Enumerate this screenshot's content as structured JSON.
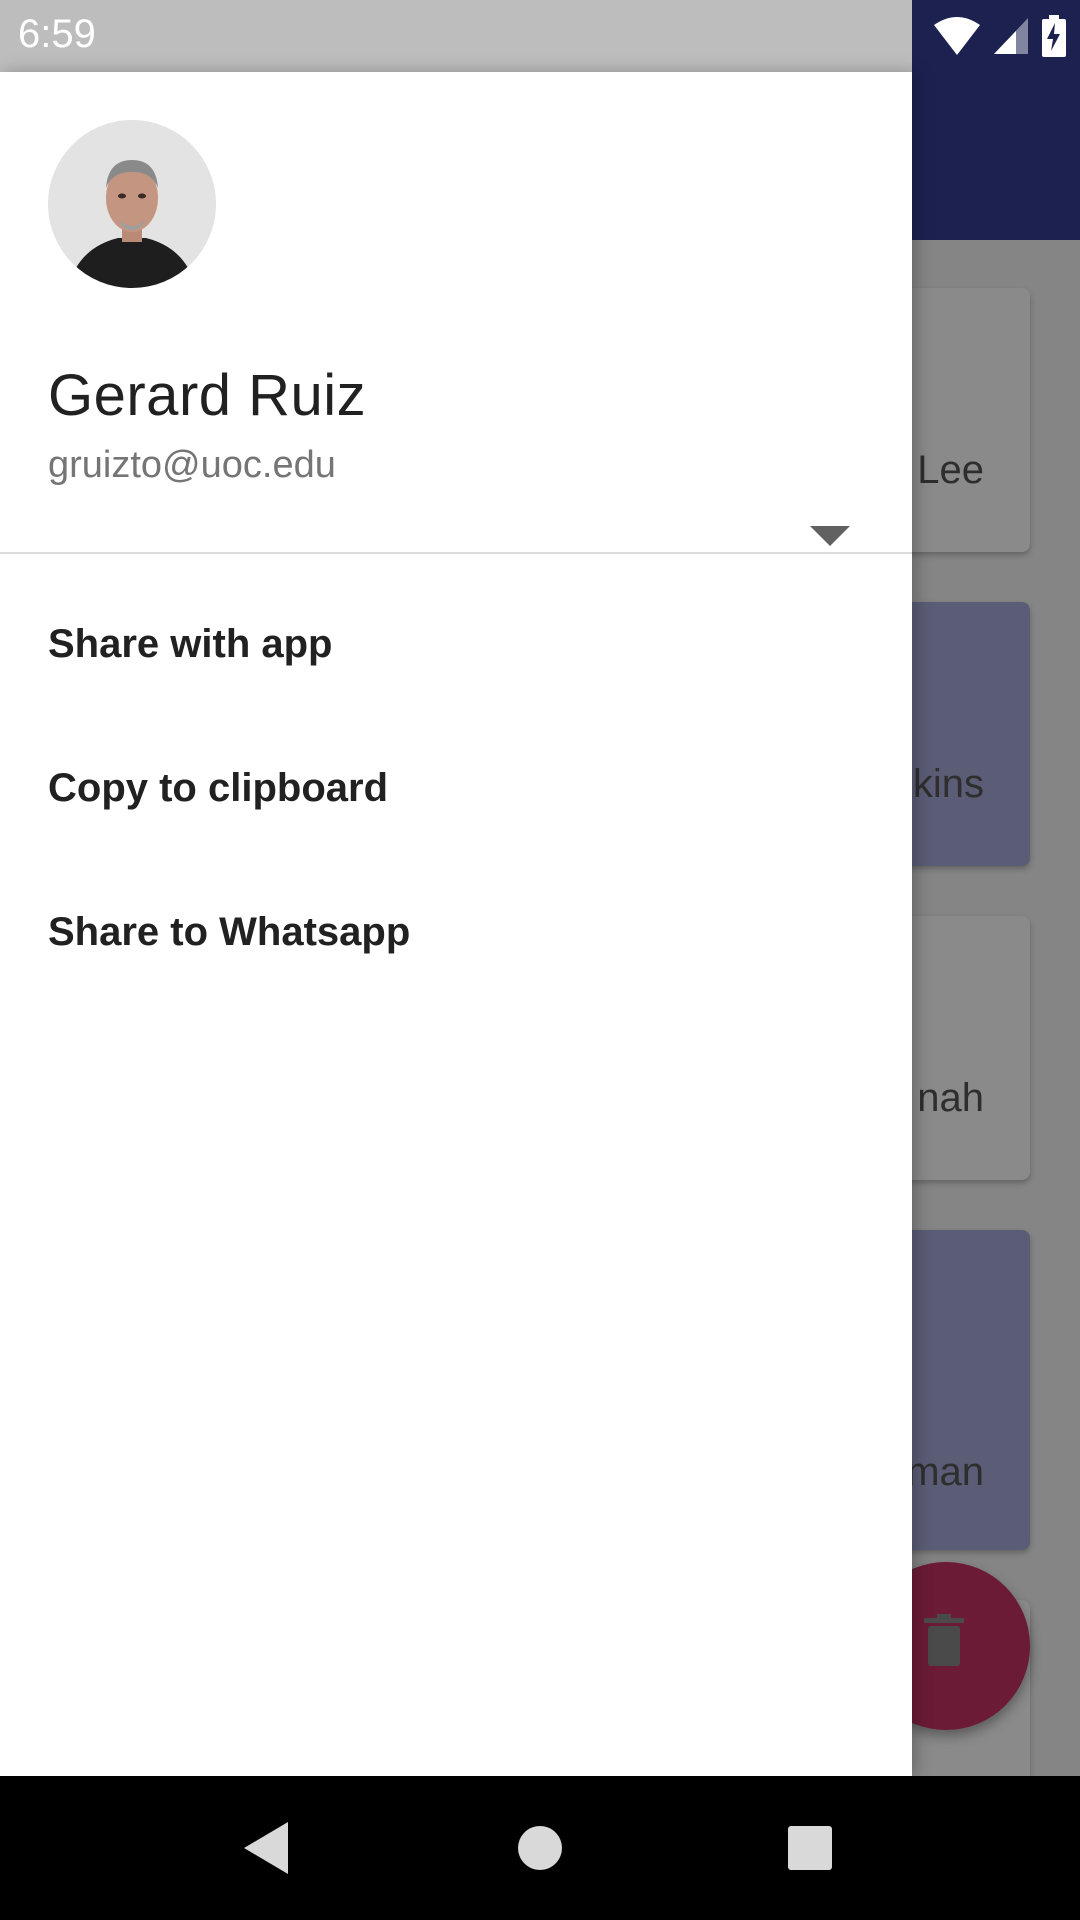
{
  "status_bar": {
    "time": "6:59",
    "icons": [
      "wifi-icon",
      "cell-signal-icon",
      "battery-charging-icon"
    ]
  },
  "background_app": {
    "cards": [
      {
        "text_fragment": "Lee",
        "tint": "light"
      },
      {
        "text_fragment": "kins",
        "tint": "purple"
      },
      {
        "text_fragment": "nah",
        "tint": "light"
      },
      {
        "text_fragment": "man",
        "tint": "purple"
      }
    ],
    "fab_icon": "trash-icon",
    "colors": {
      "toolbar": "#1c2150",
      "fab": "#c2185b"
    }
  },
  "drawer": {
    "user": {
      "name": "Gerard Ruiz",
      "email": "gruizto@uoc.edu"
    },
    "menu_items": [
      {
        "label": "Share with app"
      },
      {
        "label": "Copy to clipboard"
      },
      {
        "label": "Share to Whatsapp"
      }
    ]
  },
  "nav_bar": {
    "buttons": [
      "back-icon",
      "home-icon",
      "recents-icon"
    ]
  }
}
